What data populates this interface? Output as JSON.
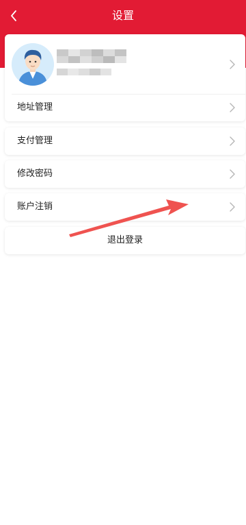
{
  "header": {
    "title": "设置",
    "back_icon": "chevron-left-icon",
    "background_color": "#e21b34"
  },
  "profile": {
    "avatar_icon": "user-avatar-icon",
    "name": "",
    "subtitle": "",
    "chevron_icon": "chevron-right-icon"
  },
  "menu": {
    "address": "地址管理",
    "payment": "支付管理",
    "password": "修改密码",
    "deactivate": "账户注销"
  },
  "logout": {
    "label": "退出登录"
  },
  "annotation": {
    "color": "#ef5350"
  }
}
